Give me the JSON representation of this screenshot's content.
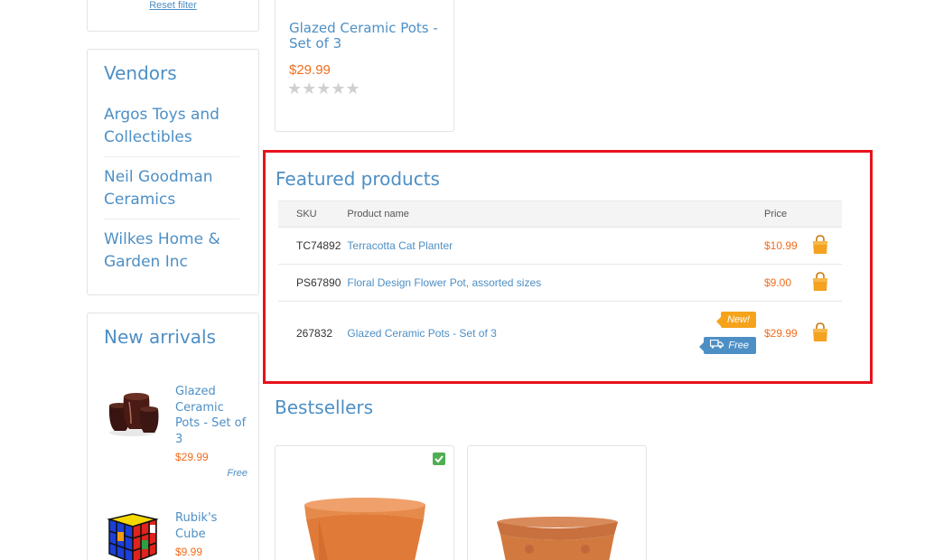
{
  "sidebar": {
    "reset_filter": "Reset filter",
    "vendors": {
      "title": "Vendors",
      "items": [
        {
          "label": "Argos Toys and Collectibles"
        },
        {
          "label": "Neil Goodman Ceramics"
        },
        {
          "label": "Wilkes Home & Garden Inc"
        }
      ]
    },
    "new_arrivals": {
      "title": "New arrivals",
      "items": [
        {
          "name": "Glazed Ceramic Pots - Set of 3",
          "price": "$29.99",
          "shipping": "Free"
        },
        {
          "name": "Rubik's Cube",
          "price": "$9.99"
        }
      ]
    }
  },
  "top_product": {
    "name": "Glazed Ceramic Pots - Set of 3",
    "price": "$29.99",
    "rating": 0,
    "stars": "★★★★★"
  },
  "featured": {
    "title": "Featured products",
    "columns": {
      "sku": "SKU",
      "name": "Product name",
      "price": "Price"
    },
    "rows": [
      {
        "sku": "TC74892",
        "name": "Terracotta Cat Planter",
        "price": "$10.99"
      },
      {
        "sku": "PS67890",
        "name": "Floral Design Flower Pot, assorted sizes",
        "price": "$9.00"
      },
      {
        "sku": "267832",
        "name": "Glazed Ceramic Pots - Set of 3",
        "price": "$29.99",
        "badge_new": "New!",
        "badge_free": "Free"
      }
    ]
  },
  "bestsellers": {
    "title": "Bestsellers"
  },
  "colors": {
    "link": "#4d8fc5",
    "price": "#f06d1e",
    "highlight": "#e8121b",
    "new_badge": "#f6a31c",
    "bag": "#f4a21f"
  }
}
